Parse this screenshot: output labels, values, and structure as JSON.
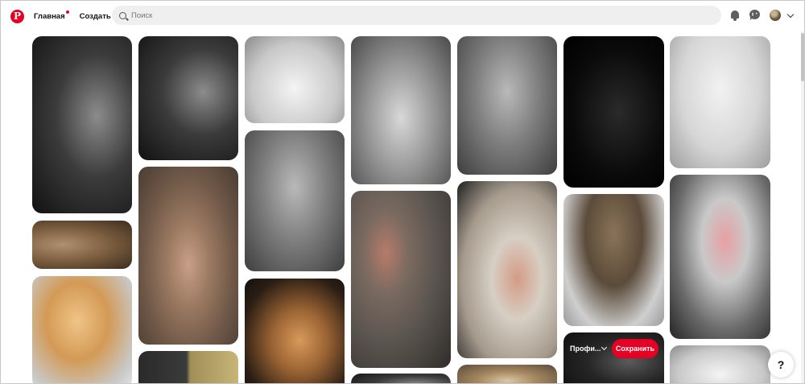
{
  "header": {
    "logo": "pinterest-logo",
    "nav": [
      {
        "label": "Главная",
        "active": true,
        "badge": "dot"
      },
      {
        "label": "Создать",
        "active": false
      }
    ],
    "search": {
      "placeholder": "Поиск",
      "value": ""
    },
    "icons": [
      "bell-icon",
      "chat-icon",
      "avatar",
      "chevron-down-icon"
    ]
  },
  "pin_hover": {
    "board_label": "Профи...",
    "save_label": "Сохранить"
  },
  "help": {
    "label": "?"
  },
  "colors": {
    "brand": "#e60023",
    "search_bg": "#efefef"
  }
}
